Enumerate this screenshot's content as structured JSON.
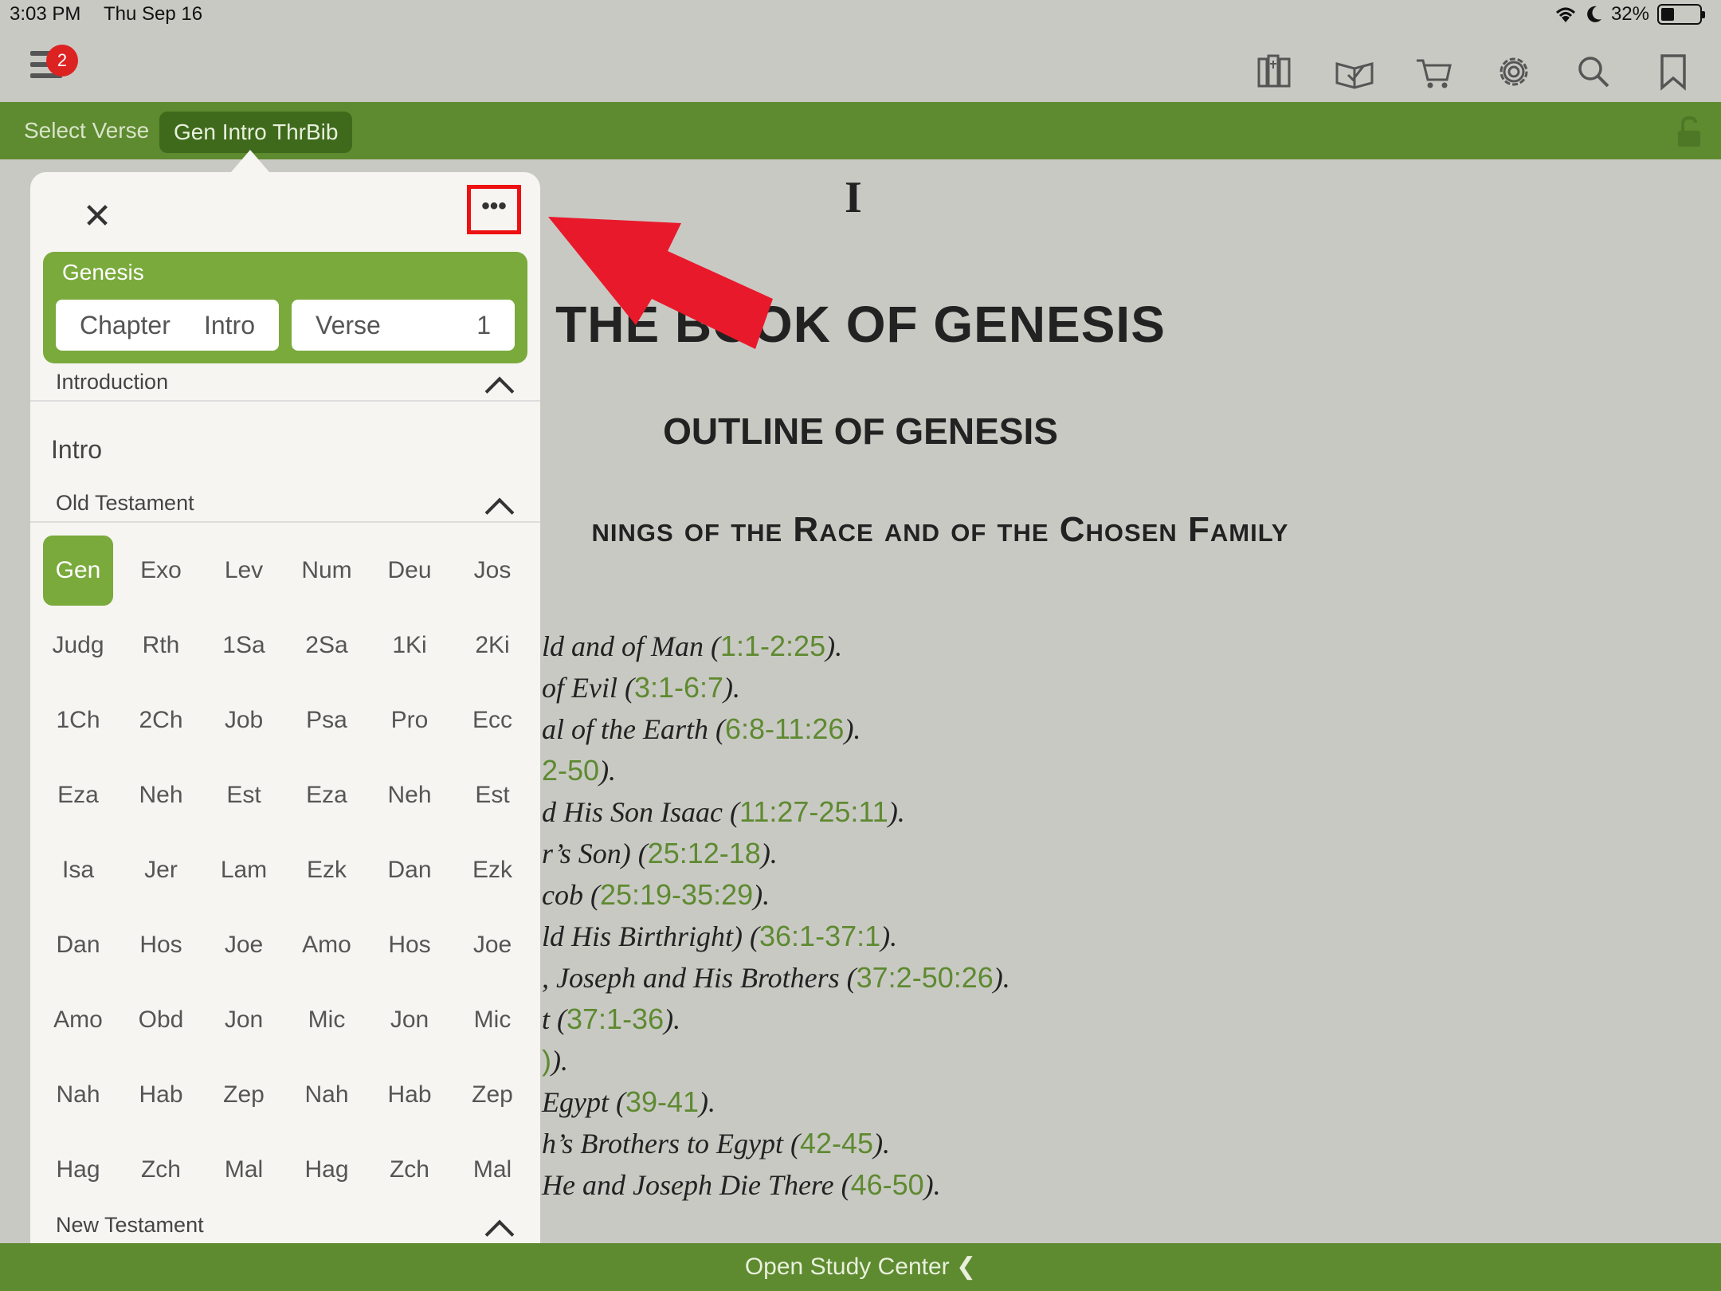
{
  "status": {
    "time": "3:03 PM",
    "date": "Thu Sep 16",
    "battery": "32%"
  },
  "toolbar": {
    "badge": "2",
    "icons": [
      "library-icon",
      "reading-plan-icon",
      "cart-icon",
      "settings-icon",
      "search-icon",
      "bookmark-icon"
    ]
  },
  "nav": {
    "select_verse": "Select Verse",
    "reference": "Gen Intro ThrBib"
  },
  "content": {
    "chapter_marker": "I",
    "book_title": "THE BOOK OF GENESIS",
    "outline_title": "OUTLINE OF GENESIS",
    "section_title": "nings of the Race and of the Chosen Family",
    "lines": [
      {
        "text": "ld and of Man (",
        "ref": "1:1-2:25",
        "end": ")."
      },
      {
        "text": " of Evil (",
        "ref": "3:1-6:7",
        "end": ")."
      },
      {
        "text": "al of the Earth (",
        "ref": "6:8-11:26",
        "end": ")."
      },
      {
        "text": "",
        "ref": "2-50",
        "end": ")."
      },
      {
        "text": "d His Son Isaac (",
        "ref": "11:27-25:11",
        "end": ")."
      },
      {
        "text": "r’s Son) (",
        "ref": "25:12-18",
        "end": ")."
      },
      {
        "text": "cob (",
        "ref": "25:19-35:29",
        "end": ")."
      },
      {
        "text": "ld His Birthright) (",
        "ref": "36:1-37:1",
        "end": ")."
      },
      {
        "text": ", Joseph and His Brothers (",
        "ref": "37:2-50:26",
        "end": ")."
      },
      {
        "text": "t (",
        "ref": "37:1-36",
        "end": ")."
      },
      {
        "text": "",
        "ref": ")",
        "end": ")."
      },
      {
        "text": " Egypt (",
        "ref": "39-41",
        "end": ")."
      },
      {
        "text": "h’s Brothers to Egypt (",
        "ref": "42-45",
        "end": ")."
      },
      {
        "text": " He and Joseph Die There (",
        "ref": "46-50",
        "end": ")."
      }
    ]
  },
  "popover": {
    "close": "✕",
    "more": "•••",
    "book": "Genesis",
    "chapter_label": "Chapter",
    "chapter_value": "Intro",
    "verse_label": "Verse",
    "verse_value": "1",
    "introduction": "Introduction",
    "intro_item": "Intro",
    "old_testament": "Old Testament",
    "new_testament": "New Testament",
    "books": [
      "Gen",
      "Exo",
      "Lev",
      "Num",
      "Deu",
      "Jos",
      "Judg",
      "Rth",
      "1Sa",
      "2Sa",
      "1Ki",
      "2Ki",
      "1Ch",
      "2Ch",
      "Job",
      "Psa",
      "Pro",
      "Ecc",
      "Eza",
      "Neh",
      "Est",
      "Eza",
      "Neh",
      "Est",
      "Isa",
      "Jer",
      "Lam",
      "Ezk",
      "Dan",
      "Ezk",
      "Dan",
      "Hos",
      "Joe",
      "Amo",
      "Hos",
      "Joe",
      "Amo",
      "Obd",
      "Jon",
      "Mic",
      "Jon",
      "Mic",
      "Nah",
      "Hab",
      "Zep",
      "Nah",
      "Hab",
      "Zep",
      "Hag",
      "Zch",
      "Mal",
      "Hag",
      "Zch",
      "Mal"
    ]
  },
  "bottom": {
    "study_center": "Open Study Center ❮"
  },
  "colors": {
    "accent": "#5e8a30",
    "highlight": "#e11"
  }
}
